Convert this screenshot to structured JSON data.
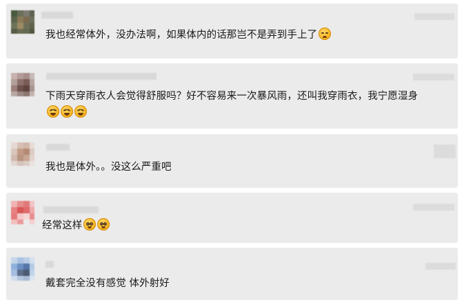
{
  "comments": [
    {
      "text": "我也经常体外，没办法啊，如果体内的话那岂不是弄到手上了",
      "emojis": [
        "crying-face-icon"
      ]
    },
    {
      "text": "下雨天穿雨衣人会觉得舒服吗？好不容易来一次暴风雨，还叫我穿雨衣，我宁愿湿身",
      "emojis": [
        "laughing-face-icon",
        "laughing-face-icon",
        "laughing-face-icon"
      ]
    },
    {
      "text": "我也是体外。。没这么严重吧",
      "emojis": []
    },
    {
      "text": "经常这样",
      "emojis": [
        "pleading-face-icon",
        "pleading-face-icon"
      ]
    },
    {
      "text": "戴套完全没有感觉 体外射好",
      "emojis": []
    }
  ]
}
